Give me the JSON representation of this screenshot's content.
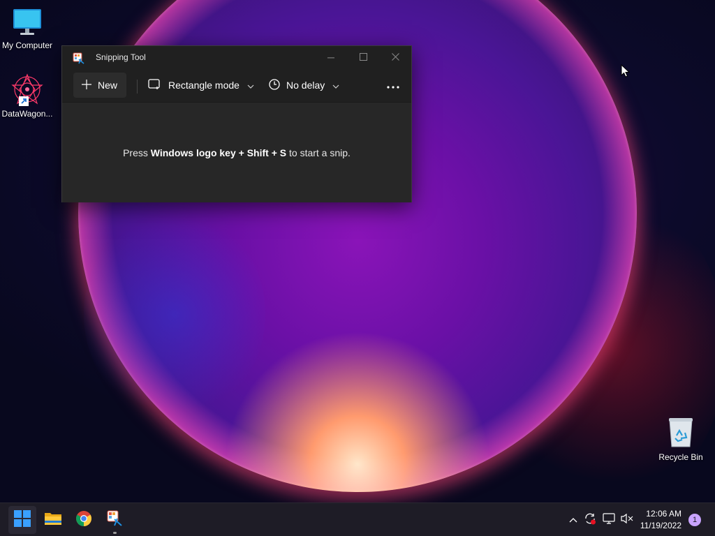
{
  "desktop": {
    "icons": [
      {
        "label": "My Computer",
        "icon": "monitor-icon"
      },
      {
        "label": "DataWagon...",
        "icon": "datawagon-shortcut-icon"
      },
      {
        "label": "Recycle Bin",
        "icon": "recycle-bin-icon"
      }
    ]
  },
  "snipping_tool": {
    "title": "Snipping Tool",
    "new_label": "New",
    "mode_label": "Rectangle mode",
    "delay_label": "No delay",
    "hint": {
      "prefix": "Press ",
      "keys": "Windows logo key + Shift + S",
      "suffix": " to start a snip."
    }
  },
  "taskbar": {
    "apps": [
      "start-button",
      "file-explorer",
      "chrome",
      "snipping-tool"
    ],
    "clock": {
      "time": "12:06 AM",
      "date": "11/19/2022"
    },
    "notification_count": "1"
  },
  "colors": {
    "window_bg": "#202020",
    "window_body": "#272727",
    "taskbar_bg": "#1e1c26",
    "accent": "#0078d4"
  }
}
